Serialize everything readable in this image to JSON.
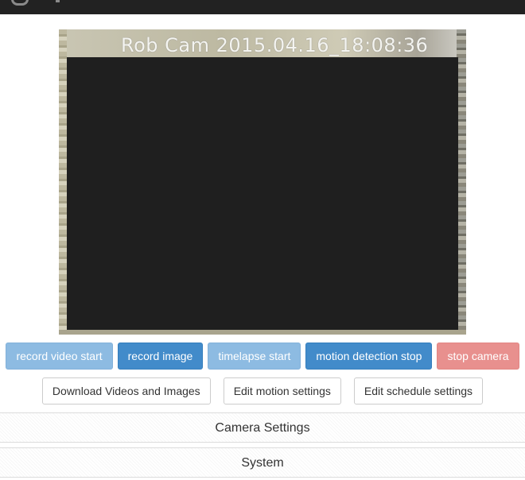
{
  "camera": {
    "overlay_text": "Rob Cam 2015.04.16_18:08:36"
  },
  "actions": {
    "record_video_start": "record video start",
    "record_image": "record image",
    "timelapse_start": "timelapse start",
    "motion_detection_stop": "motion detection stop",
    "stop_camera": "stop camera"
  },
  "links": {
    "download": "Download Videos and Images",
    "edit_motion": "Edit motion settings",
    "edit_schedule": "Edit schedule settings"
  },
  "panels": {
    "camera_settings": "Camera Settings",
    "system": "System"
  },
  "colors": {
    "primary": "#428bca",
    "primary_disabled": "#8dbbe2",
    "danger_disabled": "#e8908e",
    "navbar": "#222222"
  }
}
